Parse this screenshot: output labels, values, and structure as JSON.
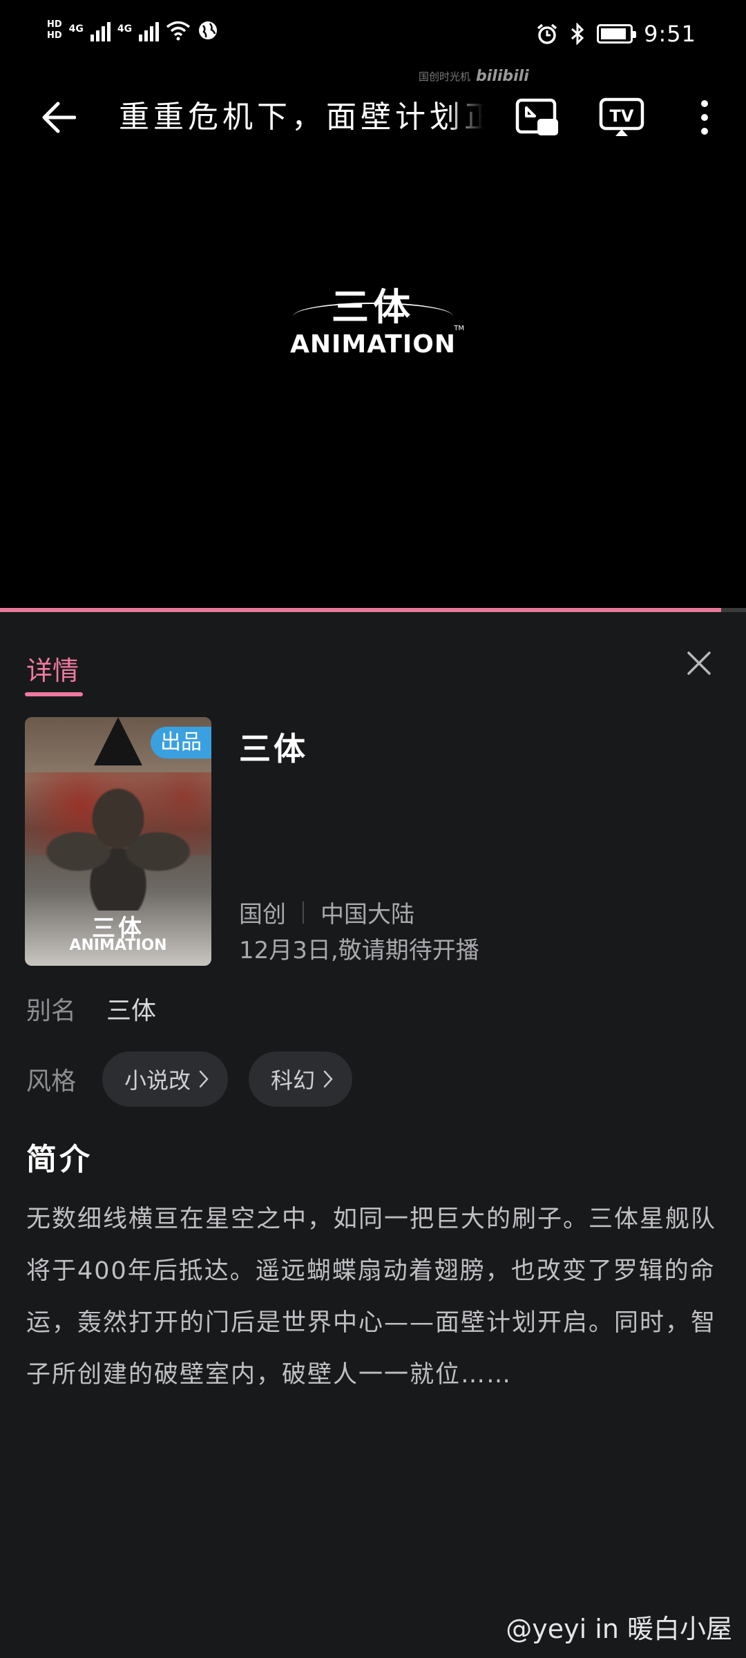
{
  "status_bar": {
    "hd_top": "HD",
    "hd_bottom": "HD",
    "network_1": "4G",
    "network_2": "4G",
    "time": "9:51"
  },
  "watermark": {
    "text": "国创时光机",
    "brand": "bilibili"
  },
  "header": {
    "video_title": "重重危机下，面壁计划正式启动",
    "icons": [
      "back-arrow-icon",
      "picture-in-picture-icon",
      "tv-cast-icon",
      "more-vertical-icon"
    ]
  },
  "logo": {
    "cn": "三体",
    "en": "ANIMATION",
    "tm": "TM"
  },
  "player": {
    "progress": 0.967,
    "progress_color": "#e8799b"
  },
  "detail": {
    "tab_label": "详情",
    "accent_color": "#ef7a9f",
    "poster": {
      "badge": "出品",
      "cn": "三体",
      "en": "ANIMATION"
    },
    "title": "三体",
    "category": "国创",
    "region": "中国大陆",
    "release_note": "12月3日,敬请期待开播",
    "alias_label": "别名",
    "alias_value": "三体",
    "style_label": "风格",
    "tags": [
      "小说改",
      "科幻"
    ],
    "intro_heading": "简介",
    "intro_text": "无数细线横亘在星空之中，如同一把巨大的刷子。三体星舰队将于400年后抵达。遥远蝴蝶扇动着翅膀，也改变了罗辑的命运，轰然打开的门后是世界中心——面壁计划开启。同时，智子所创建的破壁室内，破壁人一一就位……"
  },
  "credit": "@yeyi in 暖白小屋"
}
